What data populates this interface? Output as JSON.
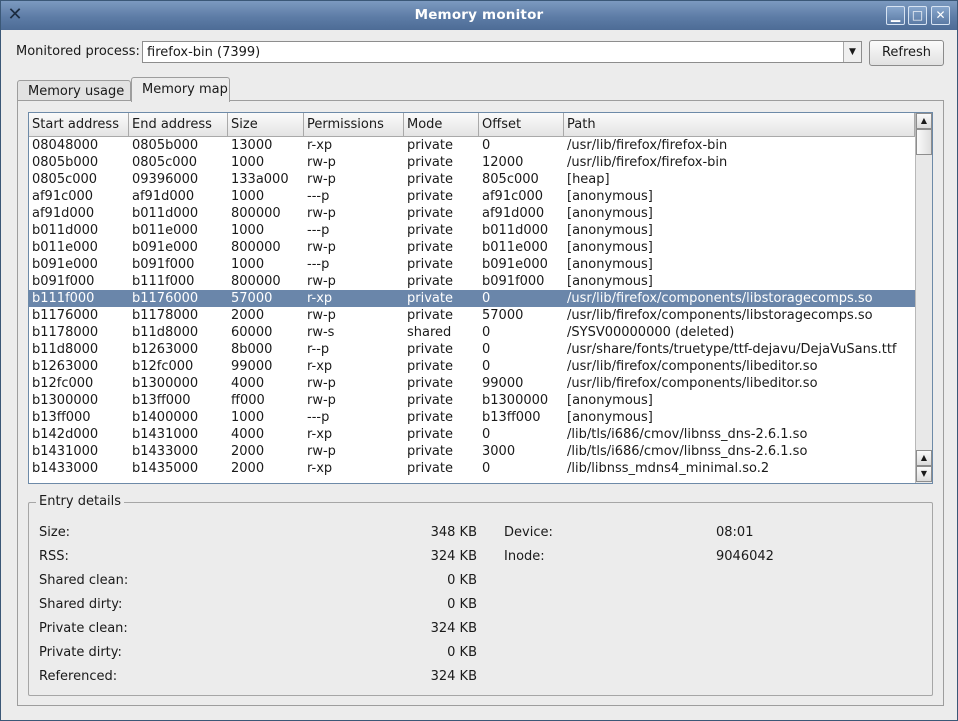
{
  "window": {
    "title": "Memory monitor",
    "minimize_glyph": "▁",
    "maximize_glyph": "□",
    "close_glyph": "✕",
    "app_icon_glyph": "✕"
  },
  "toolbar": {
    "process_label": "Monitored process:",
    "process_value": "firefox-bin (7399)",
    "refresh_label": "Refresh",
    "combo_arrow_glyph": "▼"
  },
  "tabs": [
    {
      "label": "Memory usage",
      "active": false
    },
    {
      "label": "Memory map",
      "active": true
    }
  ],
  "table": {
    "columns": [
      "Start address",
      "End address",
      "Size",
      "Permissions",
      "Mode",
      "Offset",
      "Path"
    ],
    "selected_index": 9,
    "rows": [
      [
        "08048000",
        "0805b000",
        "13000",
        "r-xp",
        "private",
        "0",
        "/usr/lib/firefox/firefox-bin"
      ],
      [
        "0805b000",
        "0805c000",
        "1000",
        "rw-p",
        "private",
        "12000",
        "/usr/lib/firefox/firefox-bin"
      ],
      [
        "0805c000",
        "09396000",
        "133a000",
        "rw-p",
        "private",
        "805c000",
        "[heap]"
      ],
      [
        "af91c000",
        "af91d000",
        "1000",
        "---p",
        "private",
        "af91c000",
        "[anonymous]"
      ],
      [
        "af91d000",
        "b011d000",
        "800000",
        "rw-p",
        "private",
        "af91d000",
        "[anonymous]"
      ],
      [
        "b011d000",
        "b011e000",
        "1000",
        "---p",
        "private",
        "b011d000",
        "[anonymous]"
      ],
      [
        "b011e000",
        "b091e000",
        "800000",
        "rw-p",
        "private",
        "b011e000",
        "[anonymous]"
      ],
      [
        "b091e000",
        "b091f000",
        "1000",
        "---p",
        "private",
        "b091e000",
        "[anonymous]"
      ],
      [
        "b091f000",
        "b111f000",
        "800000",
        "rw-p",
        "private",
        "b091f000",
        "[anonymous]"
      ],
      [
        "b111f000",
        "b1176000",
        "57000",
        "r-xp",
        "private",
        "0",
        "/usr/lib/firefox/components/libstoragecomps.so"
      ],
      [
        "b1176000",
        "b1178000",
        "2000",
        "rw-p",
        "private",
        "57000",
        "/usr/lib/firefox/components/libstoragecomps.so"
      ],
      [
        "b1178000",
        "b11d8000",
        "60000",
        "rw-s",
        "shared",
        "0",
        "/SYSV00000000 (deleted)"
      ],
      [
        "b11d8000",
        "b1263000",
        "8b000",
        "r--p",
        "private",
        "0",
        "/usr/share/fonts/truetype/ttf-dejavu/DejaVuSans.ttf"
      ],
      [
        "b1263000",
        "b12fc000",
        "99000",
        "r-xp",
        "private",
        "0",
        "/usr/lib/firefox/components/libeditor.so"
      ],
      [
        "b12fc000",
        "b1300000",
        "4000",
        "rw-p",
        "private",
        "99000",
        "/usr/lib/firefox/components/libeditor.so"
      ],
      [
        "b1300000",
        "b13ff000",
        "ff000",
        "rw-p",
        "private",
        "b1300000",
        "[anonymous]"
      ],
      [
        "b13ff000",
        "b1400000",
        "1000",
        "---p",
        "private",
        "b13ff000",
        "[anonymous]"
      ],
      [
        "b142d000",
        "b1431000",
        "4000",
        "r-xp",
        "private",
        "0",
        "/lib/tls/i686/cmov/libnss_dns-2.6.1.so"
      ],
      [
        "b1431000",
        "b1433000",
        "2000",
        "rw-p",
        "private",
        "3000",
        "/lib/tls/i686/cmov/libnss_dns-2.6.1.so"
      ],
      [
        "b1433000",
        "b1435000",
        "2000",
        "r-xp",
        "private",
        "0",
        "/lib/libnss_mdns4_minimal.so.2"
      ]
    ]
  },
  "scrollbar": {
    "up_glyph": "▲",
    "down_glyph": "▼"
  },
  "details": {
    "title": "Entry details",
    "left": [
      {
        "label": "Size:",
        "value": "348 KB"
      },
      {
        "label": "RSS:",
        "value": "324 KB"
      },
      {
        "label": "Shared clean:",
        "value": "0 KB"
      },
      {
        "label": "Shared dirty:",
        "value": "0 KB"
      },
      {
        "label": "Private clean:",
        "value": "324 KB"
      },
      {
        "label": "Private dirty:",
        "value": "0 KB"
      },
      {
        "label": "Referenced:",
        "value": "324 KB"
      }
    ],
    "right": [
      {
        "label": "Device:",
        "value": "08:01"
      },
      {
        "label": "Inode:",
        "value": "9046042"
      }
    ]
  }
}
